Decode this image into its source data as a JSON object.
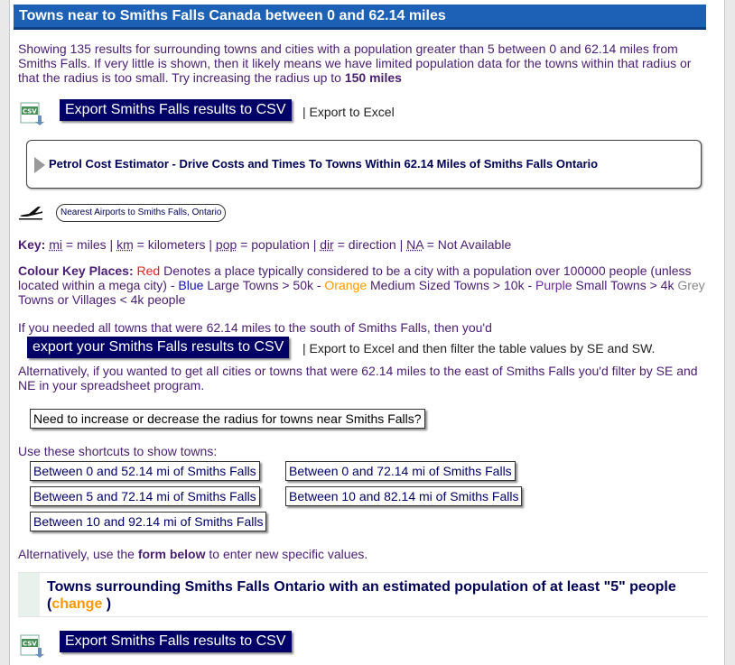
{
  "header": {
    "title": "Towns near to Smiths Falls Canada between 0 and 62.14 miles"
  },
  "intro": {
    "text": "Showing 135 results for surrounding towns and cities with a population greater than 5 between 0 and 62.14 miles from Smiths Falls. If very little is shown, then it likely means we have limited population data for the towns within that radius or that the radius is too small. Try increasing the radius up to",
    "bold_radius": "150 miles"
  },
  "export": {
    "csv_label": "Export Smiths Falls results to CSV",
    "excel_link": "| Export to Excel"
  },
  "petrol": {
    "label": "Petrol Cost Estimator - Drive Costs and Times To Towns Within 62.14 Miles of Smiths Falls Ontario"
  },
  "airports": {
    "label": "Nearest Airports to Smiths Falls, Ontario"
  },
  "key": {
    "label": "Key:",
    "mi": "mi",
    "mi_desc": " = miles | ",
    "km": "km",
    "km_desc": " = kilometers | ",
    "pop": "pop",
    "pop_desc": " = population | ",
    "dir": "dir",
    "dir_desc": " = direction | ",
    "na": "NA",
    "na_desc": " = Not Available"
  },
  "colour_key": {
    "label": "Colour Key Places:",
    "red": "Red",
    "red_desc": " Denotes a place typically considered to be a city with a population over 100000 people (unless located within a mega city) - ",
    "blue": "Blue",
    "blue_desc": " Large Towns > 50k - ",
    "orange": "Orange",
    "orange_desc": " Medium Sized Towns > 10k - ",
    "purple": "Purple",
    "purple_desc": " Small Towns > 4k ",
    "grey": "Grey",
    "grey_desc": " Towns or Villages < 4k people"
  },
  "south": {
    "text": "If you needed all towns that were 62.14 miles to the south of Smiths Falls, then you'd",
    "button": "export your Smiths Falls results to CSV",
    "after": "| Export to Excel and then filter the table values by SE and SW."
  },
  "east": {
    "text": "Alternatively, if you wanted to get all cities or towns that were 62.14 miles to the east of Smiths Falls you'd filter by SE and NE in your spreadsheet program."
  },
  "radius_button": "Need to increase or decrease the radius for towns near Smiths Falls?",
  "shortcuts": {
    "label": "Use these shortcuts to show towns:",
    "items": [
      "Between 0 and 52.14 mi of Smiths Falls",
      "Between 0 and 72.14 mi of Smiths Falls",
      "Between 5 and 72.14 mi of Smiths Falls",
      "Between 10 and 82.14 mi of Smiths Falls",
      "Between 10 and 92.14 mi of Smiths Falls"
    ]
  },
  "form_hint": {
    "before": "Alternatively, use the ",
    "bold": "form below",
    "after": " to enter new specific values."
  },
  "population": {
    "title": "Towns surrounding Smiths Falls Ontario with an estimated population of at least \"5\" people",
    "open": "(",
    "change": "change",
    "close": " )"
  },
  "icons": {
    "csv": "csv-file-icon",
    "plane": "airplane-icon",
    "arrow": "triangle-right-icon"
  }
}
